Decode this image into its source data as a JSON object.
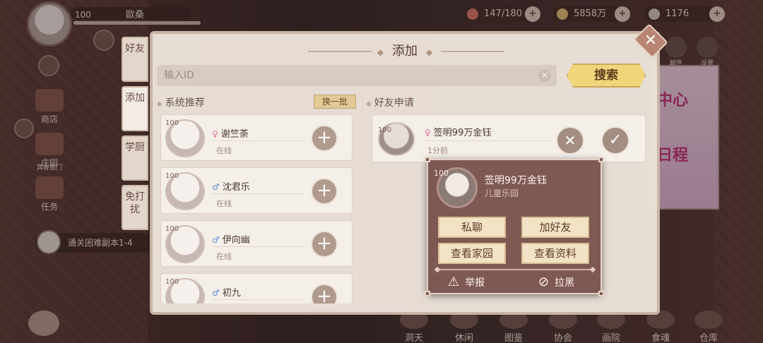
{
  "hud": {
    "player_level": "100",
    "player_name": "歐桑",
    "resources": [
      {
        "icon": "stamina-icon",
        "value": "147/180",
        "color": "#e07a6a"
      },
      {
        "icon": "feather-coin-icon",
        "value": "5858万",
        "color": "#e8c27a"
      },
      {
        "icon": "gem-icon",
        "value": "1176",
        "color": "#d8c9c0"
      }
    ]
  },
  "side_menu": {
    "shop": "商店",
    "garden": "庄园",
    "garden_sub": "宾客盈门",
    "task": "任务",
    "quest": "通关困难副本1-4"
  },
  "right_icons": {
    "mail": "邮件",
    "settings": "设置",
    "poster_line1": "中心",
    "poster_line2": "日程"
  },
  "bottom_nav": [
    "洞天",
    "休闲",
    "图鉴",
    "协会",
    "画院",
    "食魂",
    "仓库"
  ],
  "panel": {
    "title": "添加",
    "tabs": [
      "好友",
      "添加",
      "学厨",
      "免打扰"
    ],
    "search_placeholder": "输入ID",
    "search_button": "搜索",
    "rec_title": "系统推荐",
    "swap_button": "换一批",
    "req_title": "好友申请",
    "recommendations": [
      {
        "level": "100",
        "gender": "♀",
        "gender_class": "g-f",
        "name": "谢竺荼",
        "status": "在线"
      },
      {
        "level": "100",
        "gender": "♂",
        "gender_class": "g-m",
        "name": "沈君乐",
        "status": "在线"
      },
      {
        "level": "100",
        "gender": "♂",
        "gender_class": "g-m",
        "name": "伊向幽",
        "status": "在线"
      },
      {
        "level": "100",
        "gender": "♂",
        "gender_class": "g-m",
        "name": "初九",
        "status": ""
      }
    ],
    "request": {
      "level": "100",
      "gender": "♀",
      "name": "签明99万金钰",
      "time": "1分前"
    }
  },
  "popup": {
    "level": "100",
    "name": "签明99万金钰",
    "guild": "儿童乐园",
    "private_chat": "私聊",
    "add_friend": "加好友",
    "view_garden": "查看家园",
    "view_profile": "查看资料",
    "report": "举报",
    "block": "拉黑"
  }
}
